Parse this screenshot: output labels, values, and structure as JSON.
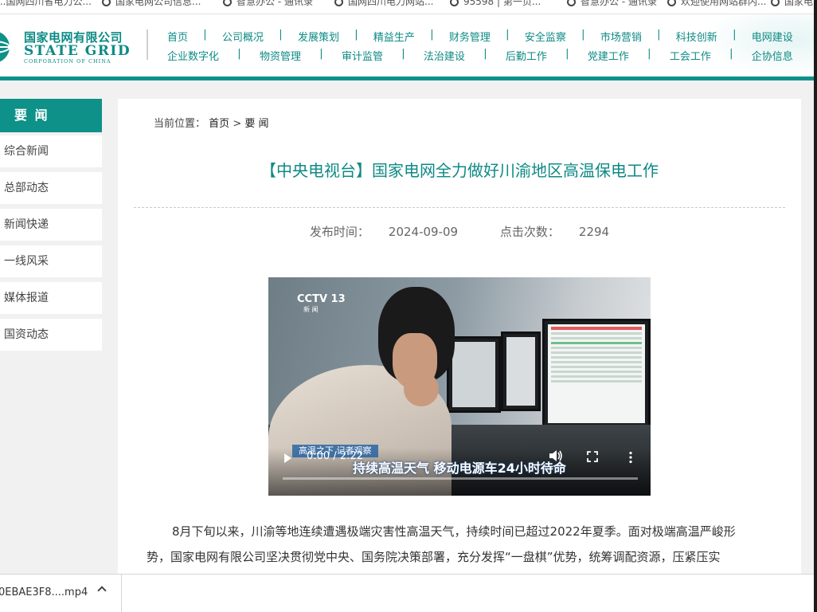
{
  "bookmarks": [
    "...国网四川省电力公...",
    "国家电网公司信息...",
    "智慧办公 - 通讯录",
    "国网四川电力网站...",
    "95598 | 第一页...",
    "智慧办公 - 通讯录",
    "欢迎使用网站群内...",
    "国家电"
  ],
  "header": {
    "logo_cn": "国家电网有限公司",
    "logo_en": "STATE GRID",
    "logo_sub": "CORPORATION OF CHINA",
    "nav_row1": [
      "首页",
      "公司概况",
      "发展策划",
      "精益生产",
      "财务管理",
      "安全监察",
      "市场营销",
      "科技创新",
      "电网建设"
    ],
    "nav_row2": [
      "企业数字化",
      "物资管理",
      "审计监管",
      "法治建设",
      "后勤工作",
      "党建工作",
      "工会工作",
      "企协信息"
    ],
    "separator": "|"
  },
  "sidebar": {
    "title": "要 闻",
    "items": [
      "综合新闻",
      "总部动态",
      "新闻快递",
      "一线风采",
      "媒体报道",
      "国资动态"
    ]
  },
  "breadcrumb": {
    "label": "当前位置：",
    "home": "首页",
    "sep": ">",
    "current": "要 闻"
  },
  "article": {
    "title": "【中央电视台】国家电网全力做好川渝地区高温保电工作",
    "publish_label": "发布时间：",
    "publish_date": "2024-09-09",
    "views_label": "点击次数：",
    "views": "2294",
    "paragraph1": "8月下旬以来，川渝等地连续遭遇极端灾害性高温天气，持续时间已超过2022年夏季。面对极端高温严峻形",
    "paragraph2": "势，国家电网有限公司坚决贯彻党中央、国务院决策部署，充分发挥“一盘棋”优势，统筹调配资源，压紧压实"
  },
  "video": {
    "channel": "CCTV 13",
    "channel_sub": "新 闻",
    "tag": "高温之下 记者观察",
    "caption": "持续高温天气 移动电源车24小时待命",
    "time": "0:00 / 2:22",
    "progress": 0
  },
  "download": {
    "filename": "0EBAE3F8....mp4"
  },
  "colors": {
    "brand_teal": "#0e9189",
    "text_teal": "#0d8a85"
  }
}
